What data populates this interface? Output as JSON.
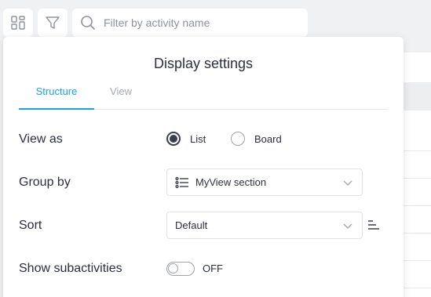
{
  "search": {
    "placeholder": "Filter by activity name"
  },
  "panel": {
    "title": "Display settings",
    "tabs": [
      {
        "label": "Structure",
        "active": true
      },
      {
        "label": "View",
        "active": false
      }
    ],
    "view_as": {
      "label": "View as",
      "options": [
        {
          "label": "List",
          "selected": true
        },
        {
          "label": "Board",
          "selected": false
        }
      ]
    },
    "group_by": {
      "label": "Group by",
      "value": "MyView section",
      "icon": "list-icon"
    },
    "sort": {
      "label": "Sort",
      "value": "Default",
      "direction_icon": "sort-lines-icon"
    },
    "subactivities": {
      "label": "Show subactivities",
      "state": "OFF",
      "on": false
    }
  },
  "colors": {
    "accent": "#1aa3e0",
    "text": "#2b2f3a",
    "muted": "#a4a9b0"
  }
}
